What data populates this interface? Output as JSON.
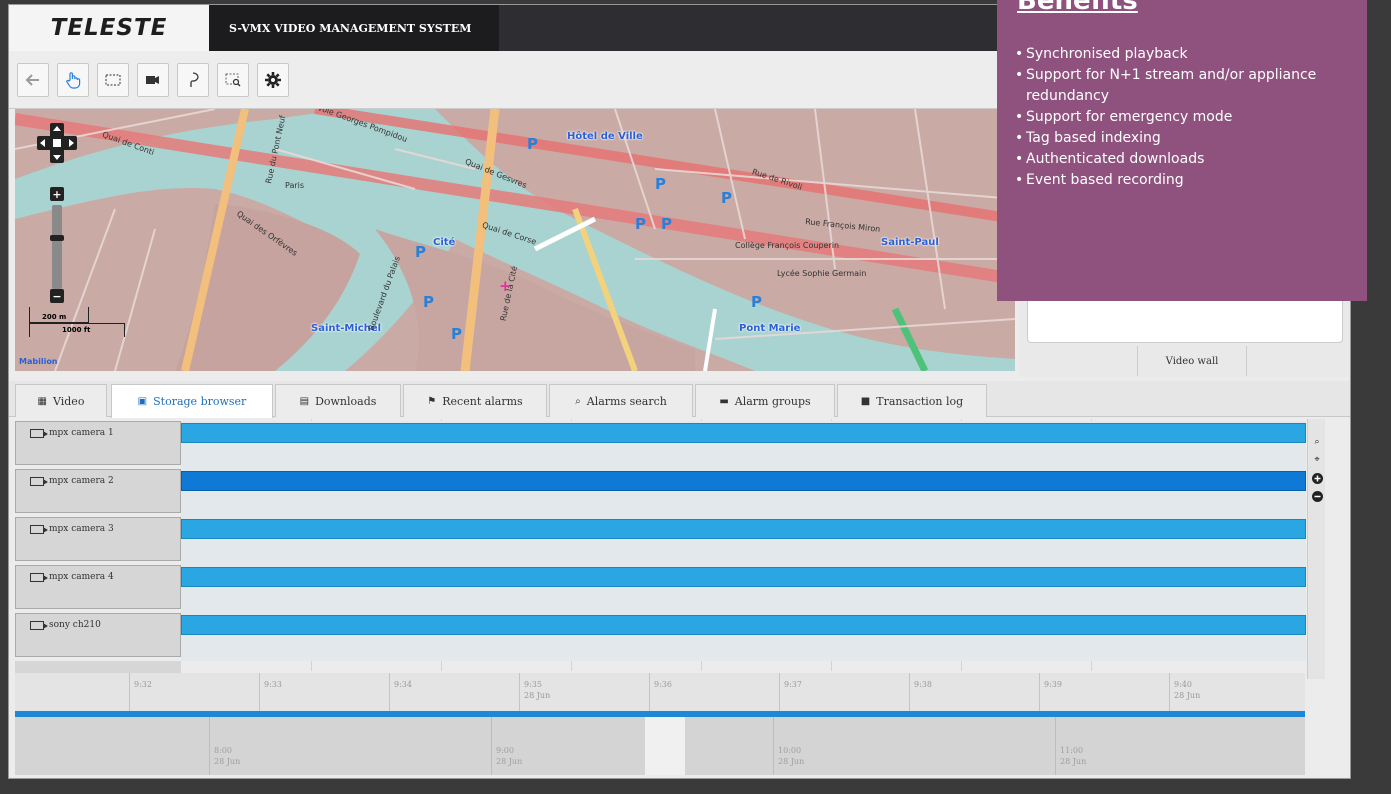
{
  "header": {
    "logo_text": "TELESTE",
    "system_title": "S-VMX VIDEO MANAGEMENT SYSTEM"
  },
  "toolbar": {
    "icons": [
      "back-arrow-icon",
      "hand-pointer-icon",
      "select-rectangle-icon",
      "camera-icon",
      "lasso-icon",
      "zoom-box-icon",
      "gear-icon"
    ]
  },
  "map": {
    "places": [
      "Hôtel de Ville",
      "Cité",
      "Saint-Michel",
      "Pont Marie",
      "Saint-Paul"
    ],
    "streets": [
      "Voie Georges Pompidou",
      "Quai de Gesvres",
      "Quai de Corse",
      "Rue de Rivoli",
      "Rue François Miron",
      "Rue de la Cité",
      "Boulevard du Palais",
      "Quai des Orfèvres",
      "Rue du Pont Neuf",
      "Quai de Conti",
      "Lycée Sophie Germain",
      "Collège François Couperin",
      "Paris"
    ],
    "scale_m": "200 m",
    "scale_ft": "1000 ft",
    "attribution": "Mabilion"
  },
  "right_panel": {
    "video_wall_label": "Video wall"
  },
  "tabs": [
    {
      "label": "Video",
      "icon": "grid-icon"
    },
    {
      "label": "Storage browser",
      "icon": "storage-icon"
    },
    {
      "label": "Downloads",
      "icon": "download-icon"
    },
    {
      "label": "Recent alarms",
      "icon": "flag-icon"
    },
    {
      "label": "Alarms search",
      "icon": "search-icon"
    },
    {
      "label": "Alarm groups",
      "icon": "folder-icon"
    },
    {
      "label": "Transaction log",
      "icon": "log-icon"
    }
  ],
  "cameras": [
    {
      "name": "mpx camera 1"
    },
    {
      "name": "mpx camera 2"
    },
    {
      "name": "mpx camera 3"
    },
    {
      "name": "mpx camera 4"
    },
    {
      "name": "sony ch210"
    }
  ],
  "time_axis": {
    "ticks": [
      {
        "time": "9:32",
        "date": ""
      },
      {
        "time": "9:33",
        "date": ""
      },
      {
        "time": "9:34",
        "date": ""
      },
      {
        "time": "9:35",
        "date": "28 Jun"
      },
      {
        "time": "9:36",
        "date": ""
      },
      {
        "time": "9:37",
        "date": ""
      },
      {
        "time": "9:38",
        "date": ""
      },
      {
        "time": "9:39",
        "date": ""
      },
      {
        "time": "9:40",
        "date": "28 Jun"
      }
    ]
  },
  "overview_axis": {
    "ticks": [
      {
        "time": "8:00",
        "date": "28 Jun"
      },
      {
        "time": "9:00",
        "date": "28 Jun"
      },
      {
        "time": "10:00",
        "date": "28 Jun"
      },
      {
        "time": "11:00",
        "date": "28 Jun"
      }
    ]
  },
  "side_controls": [
    "search-icon",
    "pin-icon",
    "zoom-in-icon",
    "zoom-out-icon"
  ],
  "benefits": {
    "title": "Benefits",
    "items": [
      "Synchronised playback",
      "Support for N+1 stream and/or appliance redundancy",
      "Support for emergency mode",
      "Tag based indexing",
      "Authenticated downloads",
      "Event based recording"
    ]
  },
  "colors": {
    "track_bar": "#2aa6e2",
    "track_bar_selected": "#0f79d6",
    "benefits_bg": "#8f527f",
    "active_tab_text": "#1f6fb8"
  }
}
